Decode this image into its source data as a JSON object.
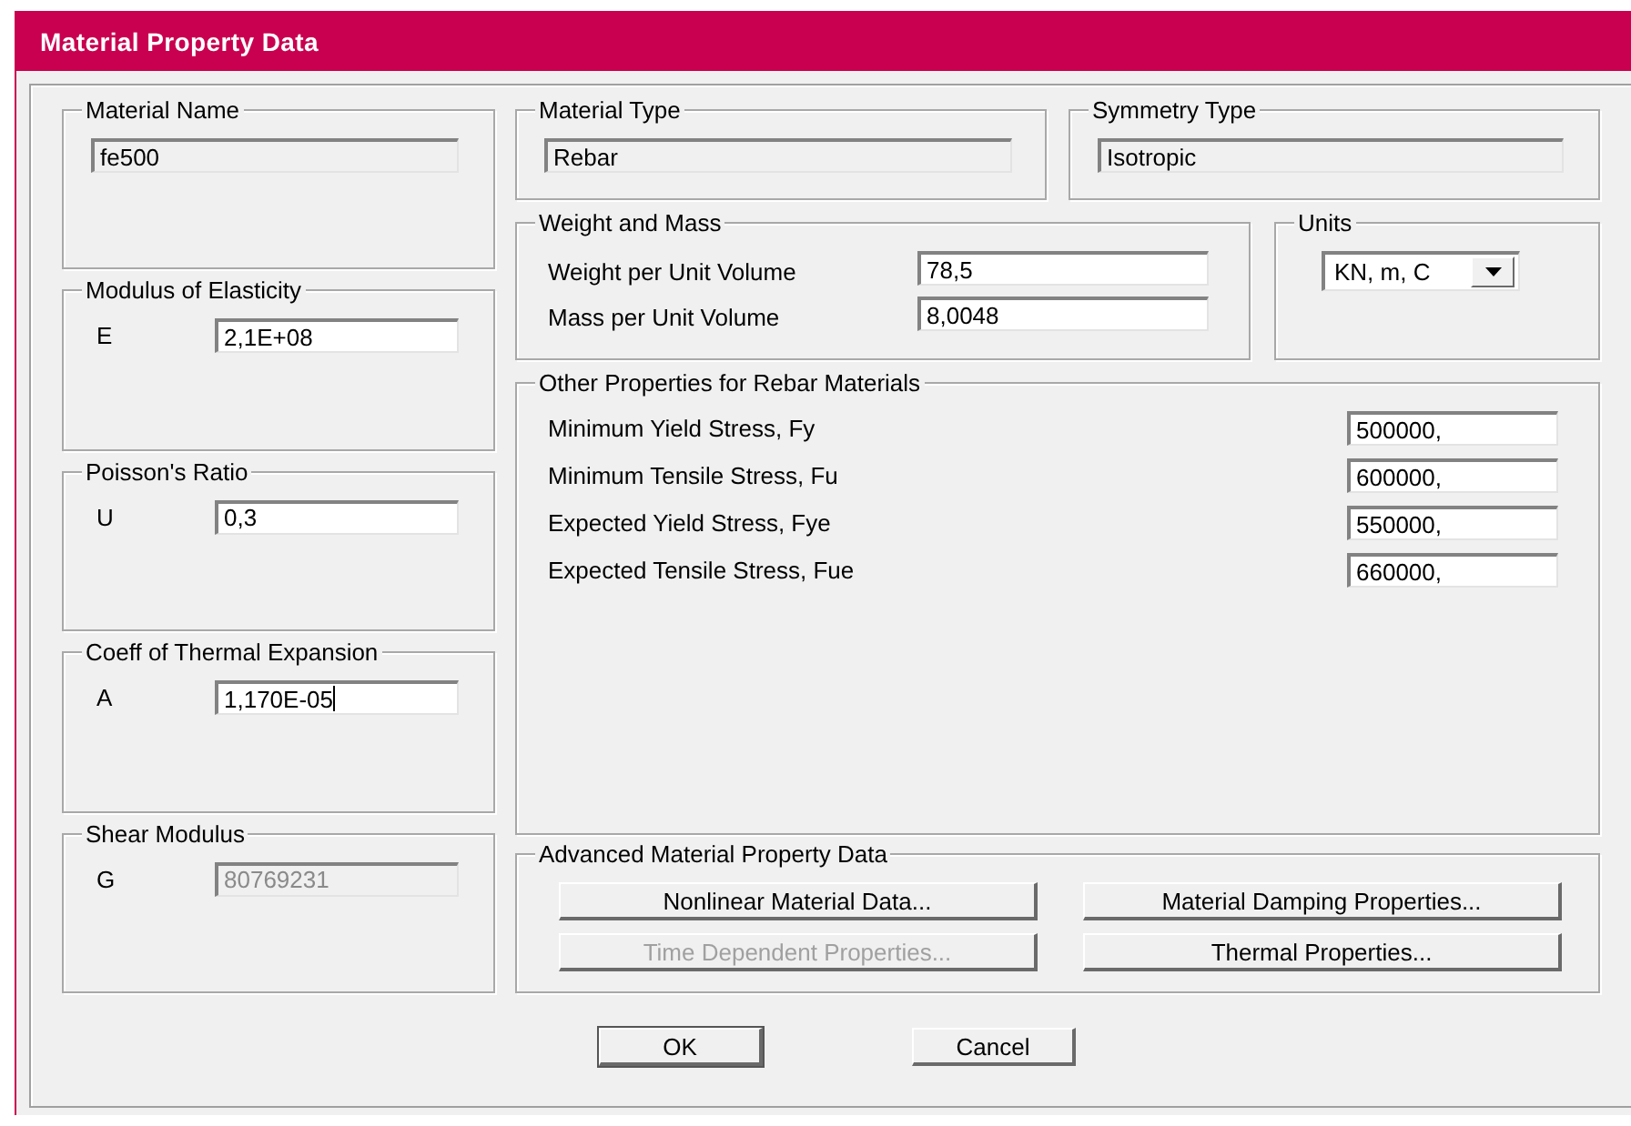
{
  "window": {
    "title": "Material Property Data"
  },
  "material_name": {
    "label": "Material Name",
    "field": {
      "value": "fe500",
      "editable": false
    }
  },
  "material_type": {
    "label": "Material Type",
    "field": {
      "value": "Rebar",
      "editable": false
    }
  },
  "symmetry_type": {
    "label": "Symmetry Type",
    "field": {
      "value": "Isotropic",
      "editable": false
    }
  },
  "modulus": {
    "label": "Modulus of Elasticity",
    "symbol": "E",
    "field": {
      "value": "2,1E+08",
      "editable": true
    }
  },
  "poisson": {
    "label": "Poisson's Ratio",
    "symbol": "U",
    "field": {
      "value": "0,3",
      "editable": true
    }
  },
  "thermal": {
    "label": "Coeff of Thermal Expansion",
    "symbol": "A",
    "field": {
      "value": "1,170E-05",
      "editable": true,
      "focused": true
    }
  },
  "shear": {
    "label": "Shear Modulus",
    "symbol": "G",
    "field": {
      "value": "80769231",
      "editable": false,
      "disabled": true
    }
  },
  "weight_mass": {
    "label": "Weight and Mass",
    "rows": [
      {
        "label": "Weight per Unit Volume",
        "value": "78,5"
      },
      {
        "label": "Mass per Unit Volume",
        "value": "8,0048"
      }
    ]
  },
  "units": {
    "label": "Units",
    "value": "KN, m, C"
  },
  "other": {
    "label": "Other Properties for Rebar Materials",
    "rows": [
      {
        "label": "Minimum Yield Stress, Fy",
        "value": "500000,"
      },
      {
        "label": "Minimum Tensile Stress, Fu",
        "value": "600000,"
      },
      {
        "label": "Expected Yield Stress, Fye",
        "value": "550000,"
      },
      {
        "label": "Expected Tensile Stress, Fue",
        "value": "660000,"
      }
    ]
  },
  "advanced": {
    "label": "Advanced Material Property Data",
    "buttons": [
      {
        "label": "Nonlinear Material Data...",
        "disabled": false
      },
      {
        "label": "Material Damping Properties...",
        "disabled": false
      },
      {
        "label": "Time Dependent Properties...",
        "disabled": true
      },
      {
        "label": "Thermal Properties...",
        "disabled": false
      }
    ]
  },
  "buttons": [
    {
      "label": "OK",
      "default": true
    },
    {
      "label": "Cancel",
      "default": false
    }
  ]
}
